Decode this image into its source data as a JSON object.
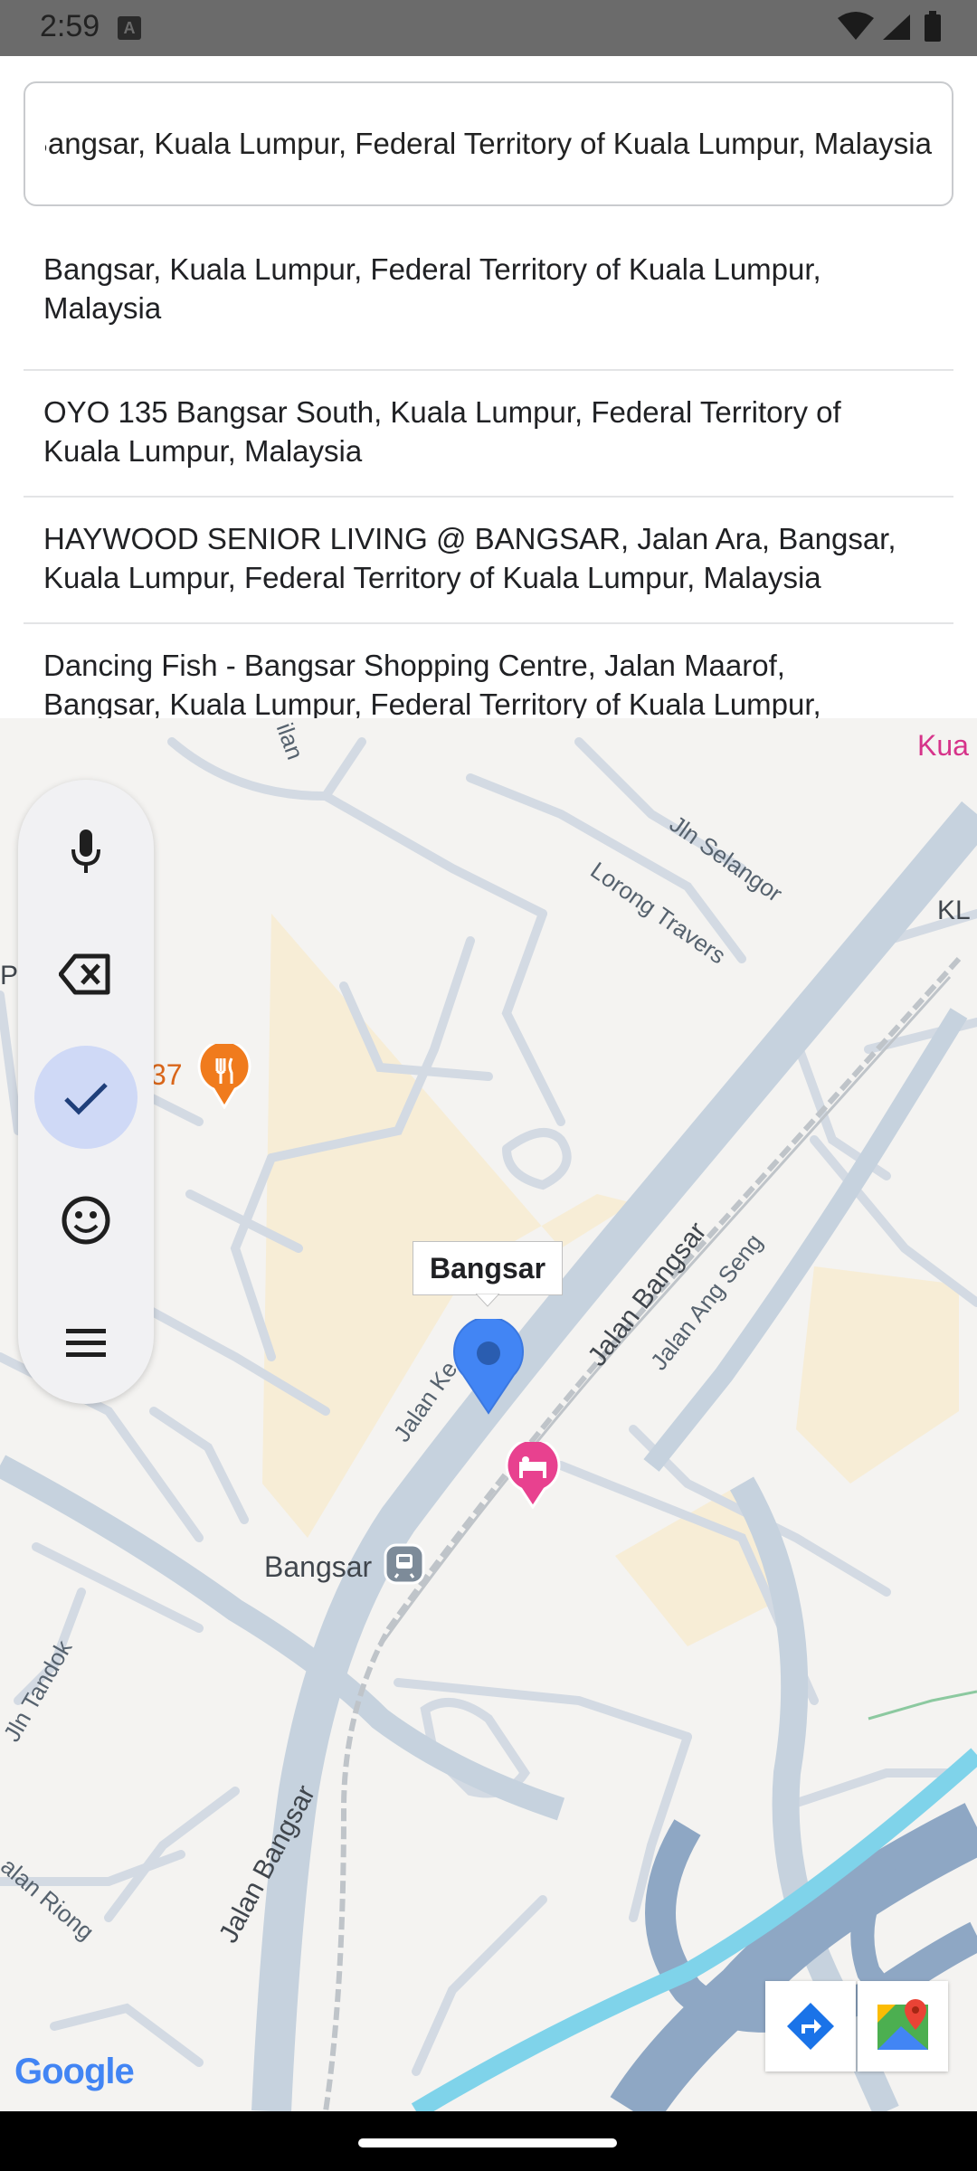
{
  "status_bar": {
    "time": "2:59",
    "notification_icon": "A"
  },
  "search": {
    "value": "Bangsar, Kuala Lumpur, Federal Territory of Kuala Lumpur, Malaysia"
  },
  "suggestions": [
    {
      "line1": "Bangsar, Kuala Lumpur, Federal Territory of Kuala Lumpur,",
      "line2": "Malaysia"
    },
    {
      "line1": "OYO 135 Bangsar South, Kuala Lumpur, Federal Territory of",
      "line2": "Kuala Lumpur, Malaysia"
    },
    {
      "line1": "HAYWOOD SENIOR LIVING @ BANGSAR, Jalan Ara, Bangsar,",
      "line2": "Kuala Lumpur, Federal Territory of Kuala Lumpur, Malaysia"
    },
    {
      "line1": "Dancing Fish - Bangsar Shopping Centre, Jalan Maarof,",
      "line2": "Bangsar, Kuala Lumpur, Federal Territory of Kuala Lumpur,"
    }
  ],
  "map": {
    "marker_label": "Bangsar",
    "station_label": "Bangsar",
    "poi_number": "37",
    "street_labels": {
      "jln_selangor": "Jln Selangor",
      "lorong_travers": "Lorong Travers",
      "jalan_bangsar_1": "Jalan Bangsar",
      "jalan_ang_seng": "Jalan Ang Seng",
      "jalan_ke": "Jalan Ke",
      "jln_tandok": "Jln Tandok",
      "jalan_bangsar_2": "Jalan Bangsar",
      "jalan_riong": "alan Riong",
      "ilan": "ilan",
      "kl": "KL",
      "kua": "Kua",
      "p": "P"
    },
    "attribution": "Google",
    "colors": {
      "marker": "#4285f4",
      "hotel": "#e8418f",
      "restaurant": "#f07b1d",
      "road": "#c9d3de",
      "water": "#7fd3ea",
      "highway": "#9bb1c9"
    }
  },
  "keyboard_toolbar": {
    "buttons": [
      "microphone-icon",
      "backspace-icon",
      "check-icon",
      "emoji-icon",
      "menu-icon"
    ],
    "active": "check-icon"
  }
}
